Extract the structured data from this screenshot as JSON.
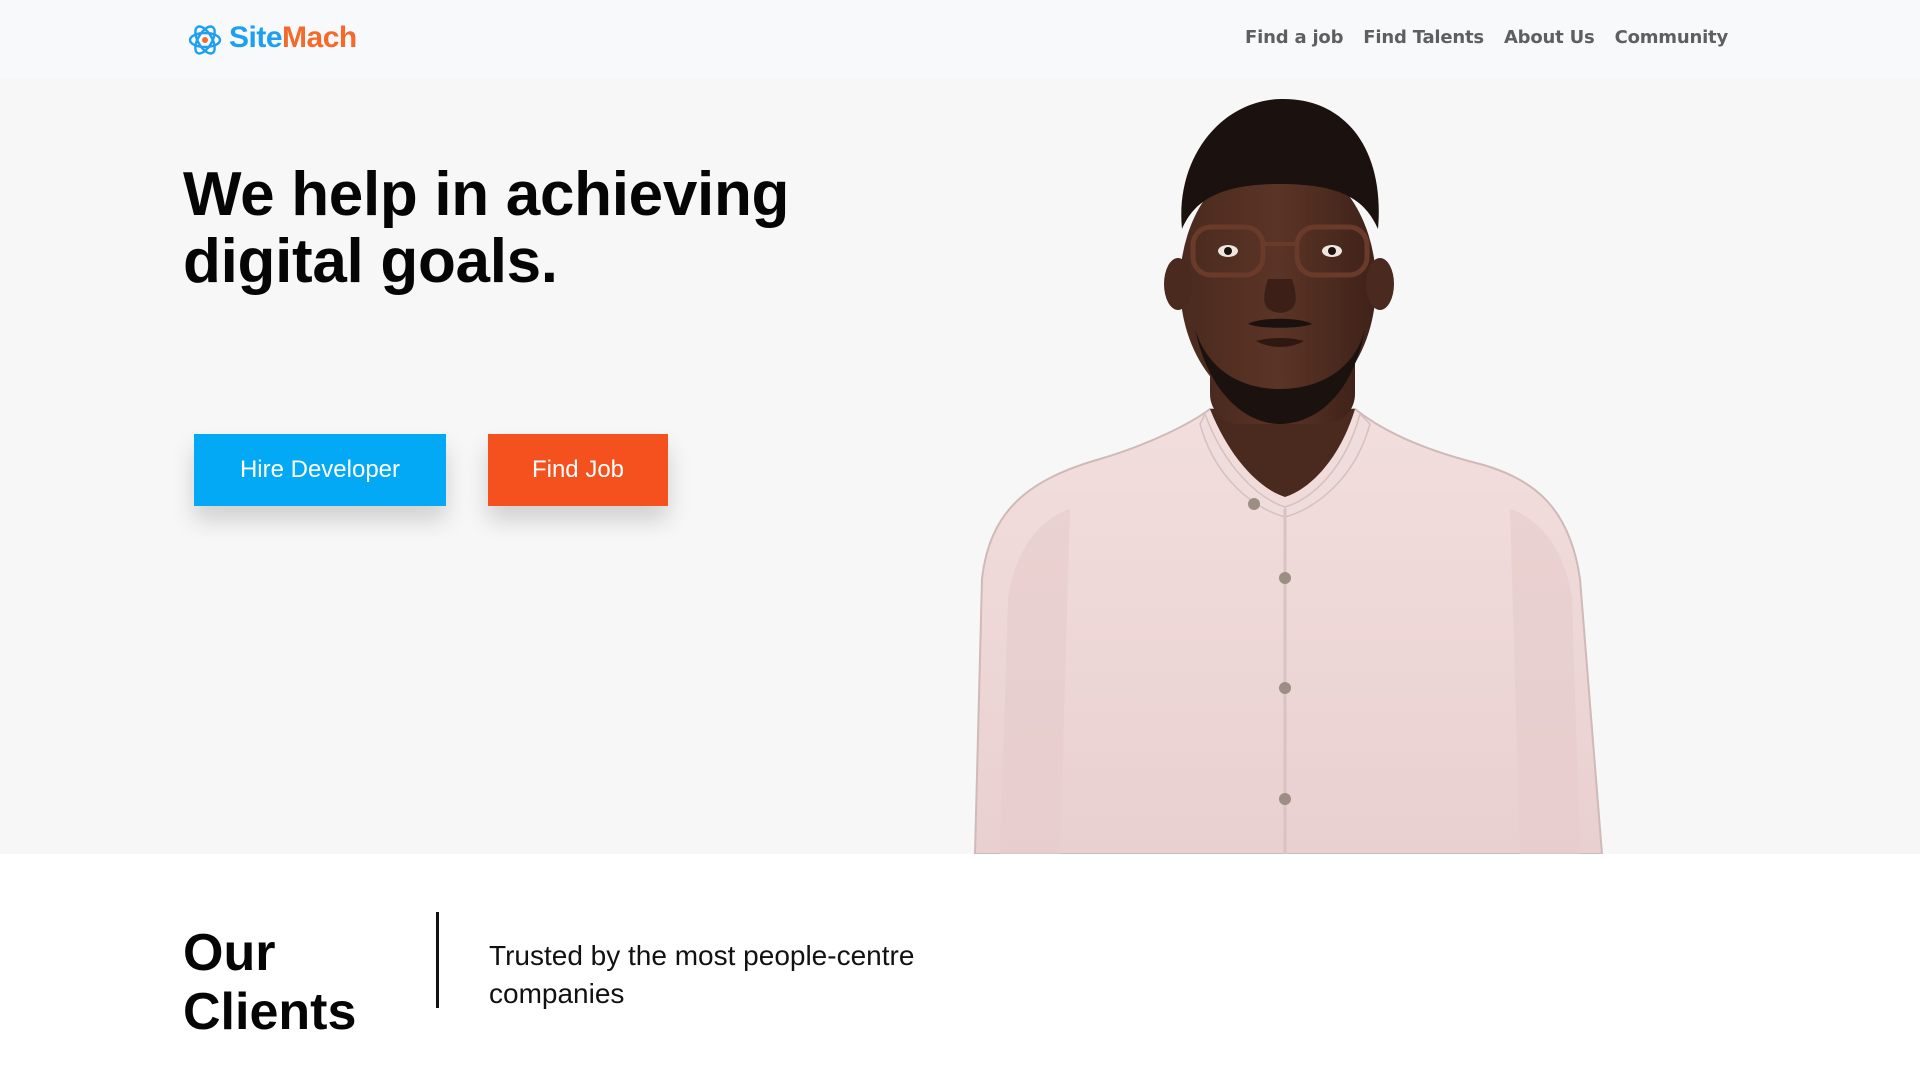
{
  "brand": {
    "name_part1": "Site",
    "name_part2": "Mach",
    "logo_icon": "atom-logo-icon",
    "colors": {
      "primary": "#1ea0f0",
      "accent": "#f36a2b"
    }
  },
  "nav": {
    "items": [
      {
        "label": "Find a job"
      },
      {
        "label": "Find Talents"
      },
      {
        "label": "About Us"
      },
      {
        "label": "Community"
      }
    ]
  },
  "hero": {
    "title": "We help in achieving digital goals.",
    "buttons": {
      "hire_label": "Hire Developer",
      "find_label": "Find Job"
    },
    "colors": {
      "hire": "#03a9f4",
      "find": "#f4511e",
      "background": "#f7f7f7"
    }
  },
  "clients": {
    "title": "Our Clients",
    "subtitle": "Trusted by the most people-centre companies"
  }
}
